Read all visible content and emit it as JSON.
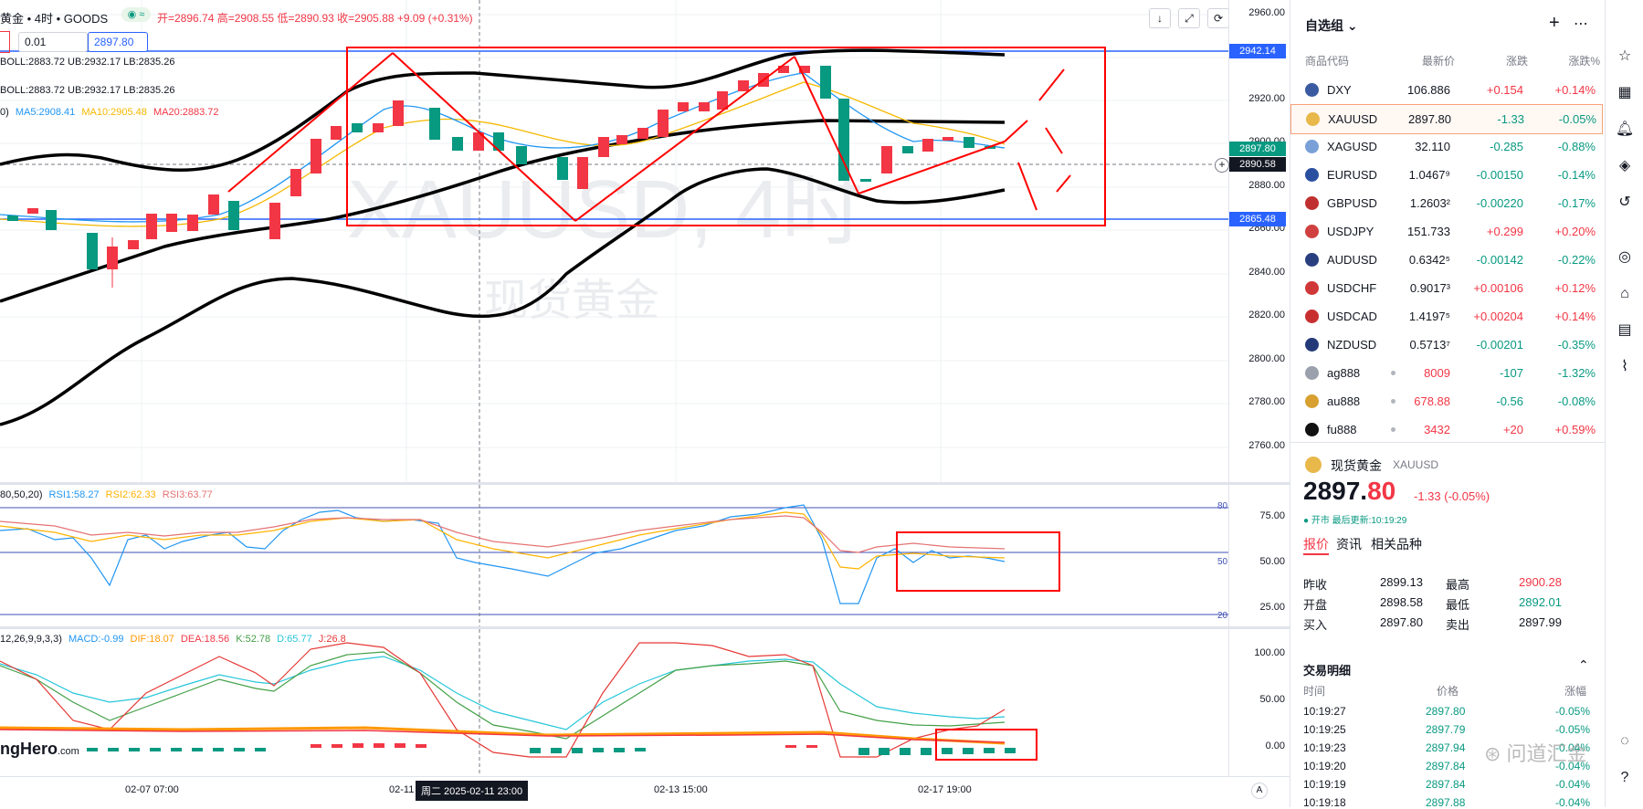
{
  "header": {
    "symbol_title": "黄金 • 4时 • GOODS",
    "ohlc": "开=2896.74 高=2908.55 低=2890.93 收=2905.88 +9.09 (+0.31%)",
    "qty_value": "0.01",
    "price_value": "2897.80"
  },
  "legends": {
    "boll1": "BOLL:2883.72  UB:2932.17  LB:2835.26",
    "boll2": "BOLL:2883.72  UB:2932.17  LB:2835.26",
    "ma_prefix": "0)",
    "ma5": "MA5:2908.41",
    "ma10": "MA10:2905.48",
    "ma20": "MA20:2883.72",
    "rsi_prefix": "80,50,20)",
    "rsi1": "RSI1:58.27",
    "rsi2": "RSI2:62.33",
    "rsi3": "RSI3:63.77",
    "kdj_prefix": "12,26,9,9,3,3)",
    "macd": "MACD:-0.99",
    "dif": "DIF:18.07",
    "dea": "DEA:18.56",
    "k": "K:52.78",
    "d": "D:65.77",
    "j": "J:26.8"
  },
  "watermark": {
    "main": "XAUUSD, 4时",
    "sub": "现货黄金",
    "brand": "ngHero",
    "brand_suffix": ".com"
  },
  "price_axis": {
    "ticks": [
      "2960.00",
      "2940.00",
      "2920.00",
      "2900.00",
      "2880.00",
      "2860.00",
      "2840.00",
      "2820.00",
      "2800.00",
      "2780.00",
      "2760.00"
    ],
    "tag_top": "2942.14",
    "tag_last": "2897.80",
    "tag_cursor": "2890.58",
    "tag_bottom": "2865.48"
  },
  "rsi_axis": {
    "ticks": [
      "75.00",
      "50.00",
      "25.00"
    ],
    "labels": [
      "80",
      "50",
      "20"
    ]
  },
  "kdj_axis": {
    "ticks": [
      "100.00",
      "50.00",
      "0.00"
    ]
  },
  "time_axis": {
    "labels": [
      "02-07  07:00",
      "02-11",
      "02-13  15:00",
      "02-17  19:00"
    ],
    "cursor": "周二 2025-02-11  23:00",
    "auto": "A"
  },
  "chart_buttons": {
    "down": "↓",
    "expand": "⤢",
    "reset": "⟳"
  },
  "watchlist": {
    "title": "自选组",
    "col_symbol": "商品代码",
    "col_last": "最新价",
    "col_change": "涨跌",
    "col_pct": "涨跌%",
    "rows": [
      {
        "sym": "DXY",
        "last": "106.886",
        "chg": "+0.154",
        "pct": "+0.14%",
        "up": true,
        "color": "#3a5ba0"
      },
      {
        "sym": "XAUUSD",
        "last": "2897.80",
        "chg": "-1.33",
        "pct": "-0.05%",
        "up": false,
        "color": "#e8b84a"
      },
      {
        "sym": "XAGUSD",
        "last": "32.110",
        "chg": "-0.285",
        "pct": "-0.88%",
        "up": false,
        "color": "#7aa0d8"
      },
      {
        "sym": "EURUSD",
        "last": "1.0467⁹",
        "chg": "-0.00150",
        "pct": "-0.14%",
        "up": false,
        "color": "#2b4fa0"
      },
      {
        "sym": "GBPUSD",
        "last": "1.2603²",
        "chg": "-0.00220",
        "pct": "-0.17%",
        "up": false,
        "color": "#c03030"
      },
      {
        "sym": "USDJPY",
        "last": "151.733",
        "chg": "+0.299",
        "pct": "+0.20%",
        "up": true,
        "color": "#d04040"
      },
      {
        "sym": "AUDUSD",
        "last": "0.6342⁵",
        "chg": "-0.00142",
        "pct": "-0.22%",
        "up": false,
        "color": "#2a3f80"
      },
      {
        "sym": "USDCHF",
        "last": "0.9017³",
        "chg": "+0.00106",
        "pct": "+0.12%",
        "up": true,
        "color": "#d03838"
      },
      {
        "sym": "USDCAD",
        "last": "1.4197⁵",
        "chg": "+0.00204",
        "pct": "+0.14%",
        "up": true,
        "color": "#c83030"
      },
      {
        "sym": "NZDUSD",
        "last": "0.5713⁷",
        "chg": "-0.00201",
        "pct": "-0.35%",
        "up": false,
        "color": "#243a78"
      },
      {
        "sym": "ag888",
        "last": "8009",
        "chg": "-107",
        "pct": "-1.32%",
        "up": false,
        "color": "#9aa0ac"
      },
      {
        "sym": "au888",
        "last": "678.88",
        "chg": "-0.56",
        "pct": "-0.08%",
        "up": false,
        "color": "#d8a030"
      },
      {
        "sym": "fu888",
        "last": "3432",
        "chg": "+20",
        "pct": "+0.59%",
        "up": true,
        "color": "#111111"
      }
    ]
  },
  "detail": {
    "name": "现货黄金",
    "code": "XAUUSD",
    "price_main": "2897.",
    "price_tail": "80",
    "change": "-1.33  (-0.05%)",
    "status": "● 开市  最后更新:10:19:29",
    "tabs": [
      "报价",
      "资讯",
      "相关品种"
    ],
    "quote": [
      {
        "l1": "昨收",
        "v1": "2899.13",
        "l2": "最高",
        "v2": "2900.28"
      },
      {
        "l1": "开盘",
        "v1": "2898.58",
        "l2": "最低",
        "v2": "2892.01"
      },
      {
        "l1": "买入",
        "v1": "2897.80",
        "l2": "卖出",
        "v2": "2897.99"
      }
    ],
    "trades_title": "交易明细",
    "trade_cols": [
      "时间",
      "价格",
      "涨幅"
    ],
    "trades": [
      {
        "t": "10:19:27",
        "p": "2897.80",
        "c": "-0.05%"
      },
      {
        "t": "10:19:25",
        "p": "2897.79",
        "c": "-0.05%"
      },
      {
        "t": "10:19:23",
        "p": "2897.94",
        "c": "-0.04%"
      },
      {
        "t": "10:19:20",
        "p": "2897.84",
        "c": "-0.04%"
      },
      {
        "t": "10:19:19",
        "p": "2897.84",
        "c": "-0.04%"
      },
      {
        "t": "10:19:18",
        "p": "2897.88",
        "c": "-0.04%"
      }
    ],
    "overlay_text": "⊛ 问道汇金"
  },
  "colors": {
    "up": "#f23645",
    "down": "#089981",
    "annotation": "#ff0000",
    "boll": "#000000",
    "level_line": "#2962ff"
  }
}
